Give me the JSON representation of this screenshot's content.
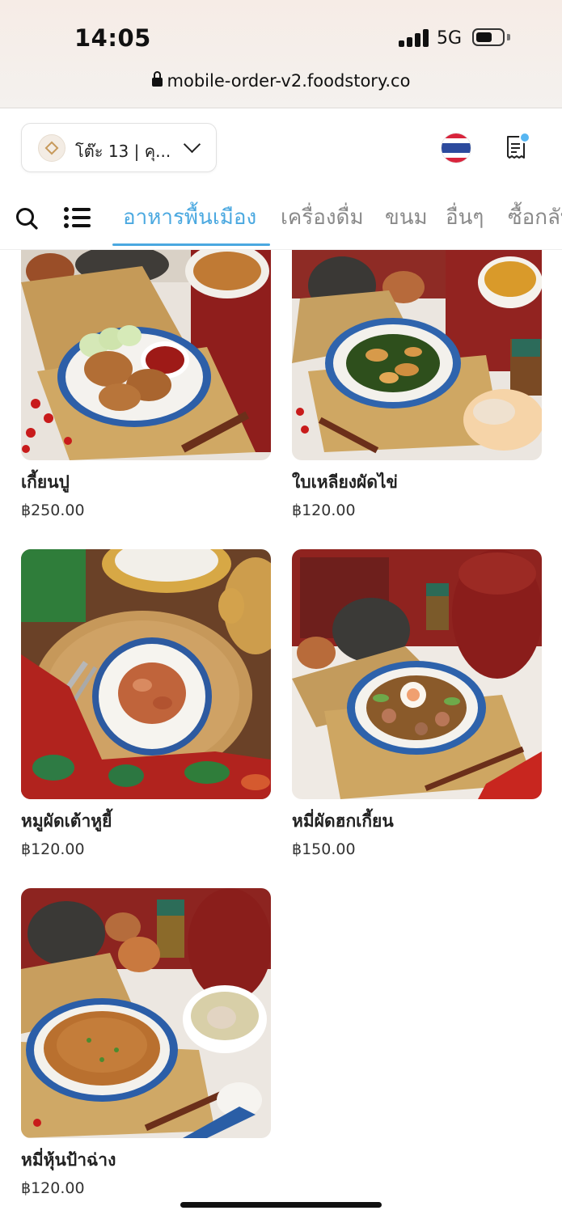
{
  "status_bar": {
    "time": "14:05",
    "network": "5G",
    "url": "mobile-order-v2.foodstory.co"
  },
  "header": {
    "table_label": "โต๊ะ 13 | คุ...",
    "language_flag": "thai-flag",
    "receipt_icon": "receipt-icon",
    "receipt_badge_color": "#57b6f2"
  },
  "tabs": {
    "items": [
      {
        "label": "อาหารพื้นเมือง",
        "active": true
      },
      {
        "label": "เครื่องดื่ม",
        "active": false
      },
      {
        "label": "ขนม",
        "active": false
      },
      {
        "label": "อื่นๆ",
        "active": false
      },
      {
        "label": "ซื้อกลับ",
        "active": false
      }
    ],
    "accent_color": "#4aa8e0"
  },
  "menu": {
    "items": [
      {
        "name": "เกี้ยนปู",
        "price": "฿250.00"
      },
      {
        "name": "ใบเหลียงผัดไข่",
        "price": "฿120.00"
      },
      {
        "name": "หมูผัดเต้าหูยี้",
        "price": "฿120.00"
      },
      {
        "name": "หมี่ผัดฮกเกี้ยน",
        "price": "฿150.00"
      },
      {
        "name": "หมี่หุ้นป้าฉ่าง",
        "price": "฿120.00"
      }
    ]
  }
}
